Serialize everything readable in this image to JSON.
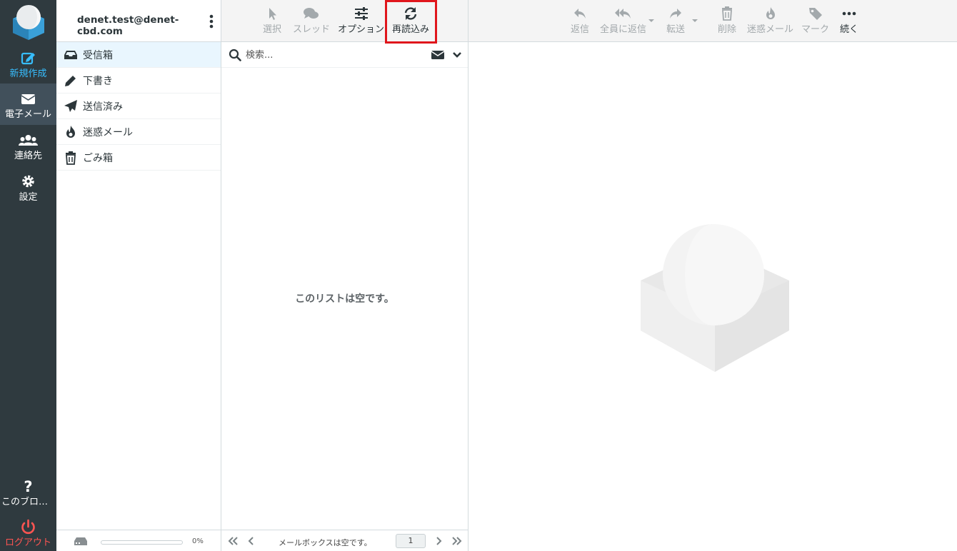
{
  "nav": {
    "compose": "新規作成",
    "mail": "電子メール",
    "contacts": "連絡先",
    "settings": "設定",
    "help": "このブログ...",
    "logout": "ログアウト"
  },
  "account": {
    "email": "denet.test@denet-cbd.com"
  },
  "folders": [
    {
      "name": "受信箱",
      "icon": "inbox-icon",
      "selected": true
    },
    {
      "name": "下書き",
      "icon": "pencil-icon"
    },
    {
      "name": "送信済み",
      "icon": "paper-plane-icon"
    },
    {
      "name": "迷惑メール",
      "icon": "fire-icon"
    },
    {
      "name": "ごみ箱",
      "icon": "trash-icon"
    }
  ],
  "quota": {
    "percent": "0%"
  },
  "list_toolbar": {
    "select": "選択",
    "threads": "スレッド",
    "options": "オプション",
    "refresh": "再読込み"
  },
  "search": {
    "placeholder": "検索..."
  },
  "list": {
    "empty": "このリストは空です。"
  },
  "pager": {
    "info": "メールボックスは空です。",
    "page": "1"
  },
  "preview_toolbar": {
    "reply": "返信",
    "reply_all": "全員に返信",
    "forward": "転送",
    "delete": "削除",
    "junk": "迷惑メール",
    "mark": "マーク",
    "more": "続く"
  },
  "colors": {
    "nav_bg": "#2f3a3f",
    "accent": "#37beff",
    "logout": "#ff5552",
    "highlight": "#e0161c"
  }
}
